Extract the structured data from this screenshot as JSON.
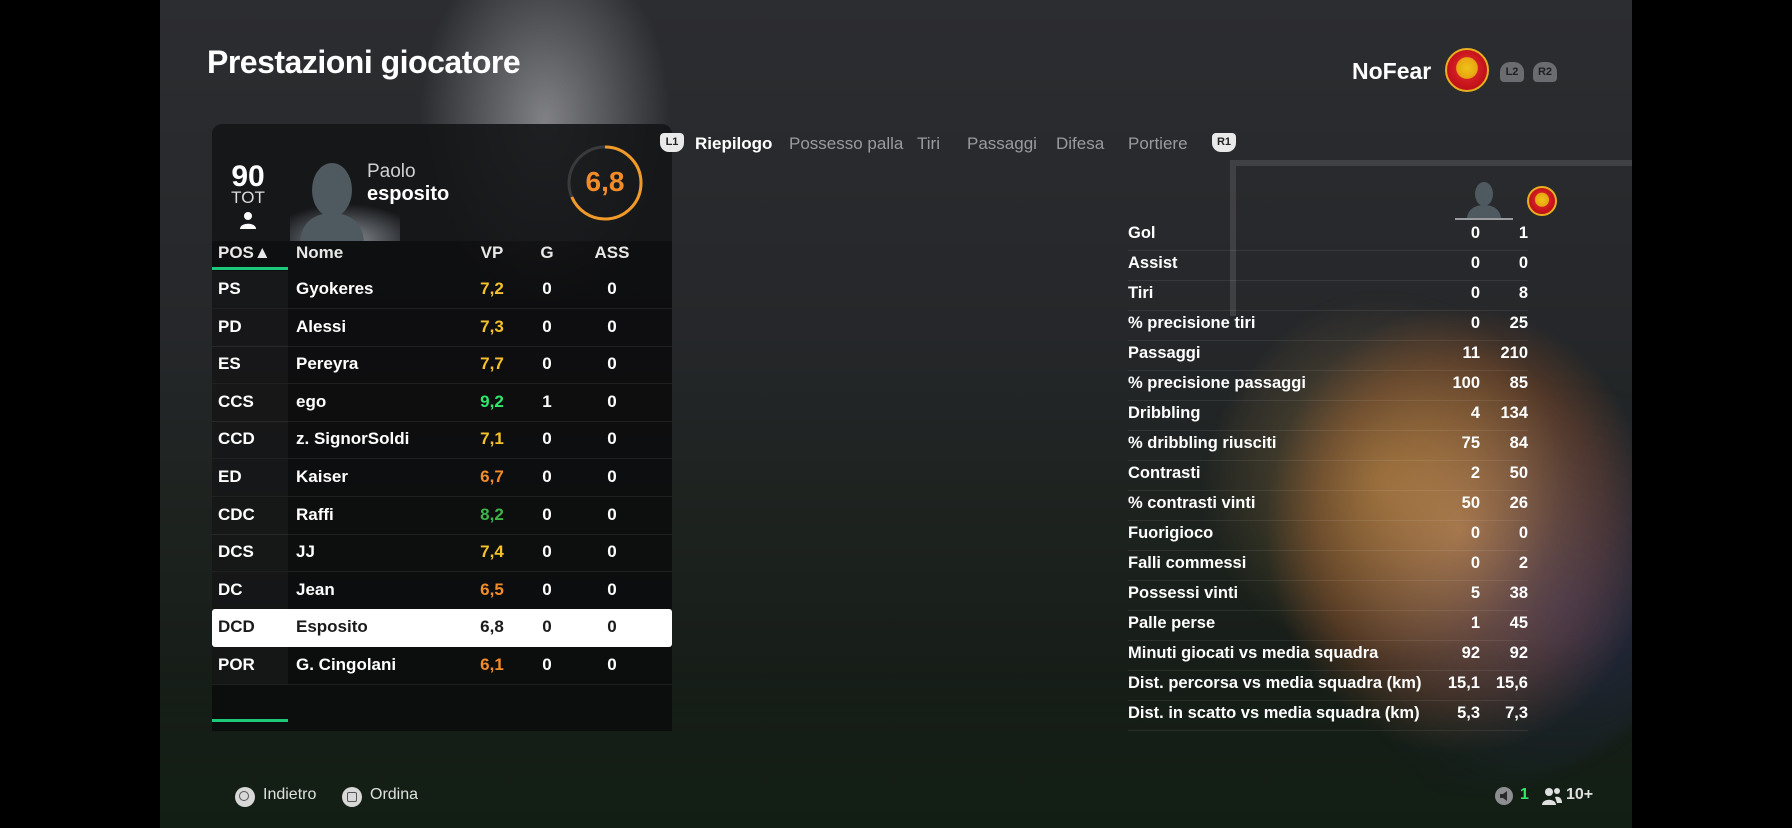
{
  "page": {
    "title": "Prestazioni giocatore"
  },
  "team": {
    "name": "NoFear",
    "crest_icon": "manchester-united-crest",
    "l2_label": "L2",
    "r2_label": "R2"
  },
  "player_card": {
    "overall": "90",
    "overall_label": "TOT",
    "first_name": "Paolo",
    "last_name": "esposito",
    "rating": "6,8",
    "rating_color": "#f28c28"
  },
  "table": {
    "headers": {
      "pos": "POS▲",
      "name": "Nome",
      "vp": "VP",
      "g": "G",
      "ass": "ASS"
    },
    "rows": [
      {
        "pos": "PS",
        "name": "Gyokeres",
        "vp": "7,2",
        "g": "0",
        "ass": "0",
        "vp_color": "#f6c12a"
      },
      {
        "pos": "PD",
        "name": "Alessi",
        "vp": "7,3",
        "g": "0",
        "ass": "0",
        "vp_color": "#f6c12a"
      },
      {
        "pos": "ES",
        "name": "Pereyra",
        "vp": "7,7",
        "g": "0",
        "ass": "0",
        "vp_color": "#f6c12a"
      },
      {
        "pos": "CCS",
        "name": "ego",
        "vp": "9,2",
        "g": "1",
        "ass": "0",
        "vp_color": "#2ee86b"
      },
      {
        "pos": "CCD",
        "name": "z. SignorSoldi",
        "vp": "7,1",
        "g": "0",
        "ass": "0",
        "vp_color": "#f6c12a"
      },
      {
        "pos": "ED",
        "name": "Kaiser",
        "vp": "6,7",
        "g": "0",
        "ass": "0",
        "vp_color": "#f28c28"
      },
      {
        "pos": "CDC",
        "name": "Raffi",
        "vp": "8,2",
        "g": "0",
        "ass": "0",
        "vp_color": "#3fb548"
      },
      {
        "pos": "DCS",
        "name": "JJ",
        "vp": "7,4",
        "g": "0",
        "ass": "0",
        "vp_color": "#f6c12a"
      },
      {
        "pos": "DC",
        "name": "Jean",
        "vp": "6,5",
        "g": "0",
        "ass": "0",
        "vp_color": "#f28c28"
      },
      {
        "pos": "DCD",
        "name": "Esposito",
        "vp": "6,8",
        "g": "0",
        "ass": "0",
        "vp_color": "#1a1a1a",
        "selected": true
      },
      {
        "pos": "POR",
        "name": "G. Cingolani",
        "vp": "6,1",
        "g": "0",
        "ass": "0",
        "vp_color": "#f28c28"
      }
    ]
  },
  "tabs": {
    "l1_label": "L1",
    "r1_label": "R1",
    "items": [
      "Riepilogo",
      "Possesso palla",
      "Tiri",
      "Passaggi",
      "Difesa",
      "Portiere"
    ],
    "active_index": 0
  },
  "stats": [
    {
      "label": "Gol",
      "player": "0",
      "team": "1"
    },
    {
      "label": "Assist",
      "player": "0",
      "team": "0"
    },
    {
      "label": "Tiri",
      "player": "0",
      "team": "8"
    },
    {
      "label": "% precisione tiri",
      "player": "0",
      "team": "25"
    },
    {
      "label": "Passaggi",
      "player": "11",
      "team": "210"
    },
    {
      "label": "% precisione passaggi",
      "player": "100",
      "team": "85"
    },
    {
      "label": "Dribbling",
      "player": "4",
      "team": "134"
    },
    {
      "label": "% dribbling riusciti",
      "player": "75",
      "team": "84"
    },
    {
      "label": "Contrasti",
      "player": "2",
      "team": "50"
    },
    {
      "label": "% contrasti vinti",
      "player": "50",
      "team": "26"
    },
    {
      "label": "Fuorigioco",
      "player": "0",
      "team": "0"
    },
    {
      "label": "Falli commessi",
      "player": "0",
      "team": "2"
    },
    {
      "label": "Possessi vinti",
      "player": "5",
      "team": "38"
    },
    {
      "label": "Palle perse",
      "player": "1",
      "team": "45"
    },
    {
      "label": "Minuti giocati vs media squadra",
      "player": "92",
      "team": "92"
    },
    {
      "label": "Dist. percorsa vs media squadra (km)",
      "player": "15,1",
      "team": "15,6"
    },
    {
      "label": "Dist. in scatto vs media squadra (km)",
      "player": "5,3",
      "team": "7,3"
    }
  ],
  "footer": {
    "back_label": "Indietro",
    "sort_label": "Ordina",
    "voice_count": "1",
    "players_count": "10+"
  }
}
